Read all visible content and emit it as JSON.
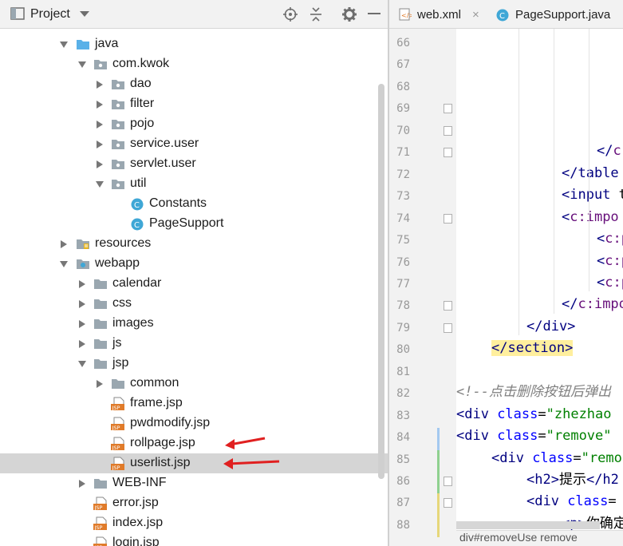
{
  "project_panel": {
    "title": "Project",
    "tree": [
      {
        "label": "java",
        "kind": "src-folder",
        "expanded": true
      },
      {
        "label": "com.kwok",
        "kind": "package",
        "expanded": true
      },
      {
        "label": "dao",
        "kind": "package",
        "expanded": false
      },
      {
        "label": "filter",
        "kind": "package",
        "expanded": false
      },
      {
        "label": "pojo",
        "kind": "package",
        "expanded": false
      },
      {
        "label": "service.user",
        "kind": "package",
        "expanded": false
      },
      {
        "label": "servlet.user",
        "kind": "package",
        "expanded": false
      },
      {
        "label": "util",
        "kind": "package",
        "expanded": true
      },
      {
        "label": "Constants",
        "kind": "class"
      },
      {
        "label": "PageSupport",
        "kind": "class"
      },
      {
        "label": "resources",
        "kind": "resources-folder",
        "expanded": false
      },
      {
        "label": "webapp",
        "kind": "web-folder",
        "expanded": true
      },
      {
        "label": "calendar",
        "kind": "folder",
        "expanded": false
      },
      {
        "label": "css",
        "kind": "folder",
        "expanded": false
      },
      {
        "label": "images",
        "kind": "folder",
        "expanded": false
      },
      {
        "label": "js",
        "kind": "folder",
        "expanded": false
      },
      {
        "label": "jsp",
        "kind": "folder",
        "expanded": true
      },
      {
        "label": "common",
        "kind": "folder",
        "expanded": false
      },
      {
        "label": "frame.jsp",
        "kind": "jsp"
      },
      {
        "label": "pwdmodify.jsp",
        "kind": "jsp"
      },
      {
        "label": "rollpage.jsp",
        "kind": "jsp"
      },
      {
        "label": "userlist.jsp",
        "kind": "jsp",
        "selected": true
      },
      {
        "label": "WEB-INF",
        "kind": "folder",
        "expanded": false
      },
      {
        "label": "error.jsp",
        "kind": "jsp"
      },
      {
        "label": "index.jsp",
        "kind": "jsp"
      },
      {
        "label": "login.jsp",
        "kind": "jsp"
      }
    ],
    "icons": {
      "header": "project-window-icon",
      "dropdown": "chevron-down-icon",
      "locate": "crosshair-icon",
      "collapse": "collapse-all-icon",
      "settings": "gear-icon",
      "hide": "minimize-icon"
    }
  },
  "editor": {
    "tabs": [
      {
        "label": "web.xml",
        "icon": "xml-file-icon",
        "close": "×"
      },
      {
        "label": "PageSupport.java",
        "icon": "class-icon"
      }
    ],
    "line_numbers": [
      "66",
      "67",
      "68",
      "69",
      "70",
      "71",
      "72",
      "73",
      "74",
      "75",
      "76",
      "77",
      "78",
      "79",
      "80",
      "81",
      "82",
      "83",
      "84",
      "85",
      "86",
      "87",
      "88"
    ],
    "lines": [
      {
        "parts": []
      },
      {
        "parts": []
      },
      {
        "parts": []
      },
      {
        "parts": []
      },
      {
        "parts": []
      },
      {
        "parts": [
          [
            "tag",
            "</"
          ],
          [
            "ns",
            "c"
          ]
        ]
      },
      {
        "parts": [
          [
            "tag",
            "</table"
          ]
        ]
      },
      {
        "parts": [
          [
            "tag",
            "<input"
          ],
          [
            "txt",
            " t"
          ]
        ]
      },
      {
        "parts": [
          [
            "tag",
            "<"
          ],
          [
            "ns",
            "c:impo"
          ]
        ]
      },
      {
        "parts": [
          [
            "tag",
            "<"
          ],
          [
            "ns",
            "c:p"
          ]
        ]
      },
      {
        "parts": [
          [
            "tag",
            "<"
          ],
          [
            "ns",
            "c:p"
          ]
        ]
      },
      {
        "parts": [
          [
            "tag",
            "<"
          ],
          [
            "ns",
            "c:p"
          ]
        ]
      },
      {
        "parts": [
          [
            "tag",
            "</"
          ],
          [
            "ns",
            "c:impo"
          ]
        ]
      },
      {
        "parts": [
          [
            "tag",
            "</div>"
          ]
        ]
      },
      {
        "parts": [
          [
            "tag",
            "</section>"
          ]
        ]
      },
      {
        "parts": []
      },
      {
        "parts": [
          [
            "cmt",
            "<!--点击删除按钮后弹出"
          ]
        ]
      },
      {
        "parts": [
          [
            "tag",
            "<div "
          ],
          [
            "attr",
            "class"
          ],
          [
            "txt",
            "="
          ],
          [
            "str",
            "\"zhezhao"
          ]
        ]
      },
      {
        "parts": [
          [
            "tag",
            "<div "
          ],
          [
            "attr",
            "class"
          ],
          [
            "txt",
            "="
          ],
          [
            "str",
            "\"remove\""
          ]
        ]
      },
      {
        "parts": [
          [
            "tag",
            "<div "
          ],
          [
            "attr",
            "class"
          ],
          [
            "txt",
            "="
          ],
          [
            "str",
            "\"remo"
          ]
        ]
      },
      {
        "parts": [
          [
            "tag",
            "<h2>"
          ],
          [
            "txt",
            "提示"
          ],
          [
            "tag",
            "</h2"
          ]
        ]
      },
      {
        "parts": [
          [
            "tag",
            "<div "
          ],
          [
            "attr",
            "class"
          ],
          [
            "txt",
            "="
          ]
        ]
      },
      {
        "parts": [
          [
            "tag",
            "<p>"
          ],
          [
            "txt",
            "你确定"
          ]
        ]
      }
    ],
    "breadcrumb": "div#removeUse remove"
  },
  "annotations": {
    "arrow_color": "#e02020",
    "arrow_targets": [
      "rollpage.jsp",
      "userlist.jsp"
    ]
  },
  "colors": {
    "selection": "#d5d5d5",
    "panel_header": "#f2f2f2",
    "package_icon": "#9aa7b0",
    "class_icon": "#3fa7d6",
    "jsp_icon": "#e07b2a"
  }
}
